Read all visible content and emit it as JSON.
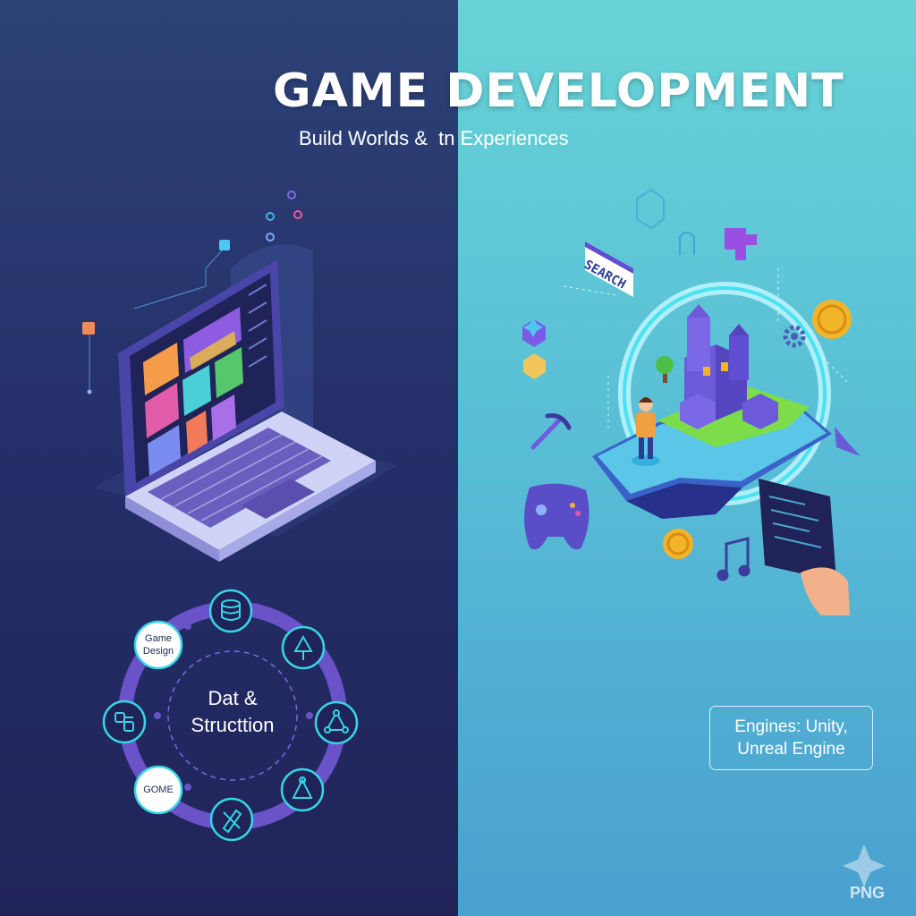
{
  "header": {
    "title": "GAME DEVELOPMENT",
    "subtitle": "Build Worlds &  tn Experiences"
  },
  "cycle": {
    "center_line1": "Dat &",
    "center_line2": "Structtion",
    "node_game_design_line1": "Game",
    "node_game_design_line2": "Design",
    "node_gome": "GOME"
  },
  "scene": {
    "search_label": "SEARCH"
  },
  "engines_box": {
    "line1": "Engines: Unity,",
    "line2": "Unreal Engine"
  },
  "watermark": {
    "text": "PNG"
  },
  "colors": {
    "left_bg": "#25306a",
    "right_bg": "#58bdd6",
    "accent_cyan": "#35d6e6",
    "accent_purple": "#6e5cc9",
    "coin_gold": "#f2b52a"
  },
  "icons": [
    "database-icon",
    "tree-icon",
    "network-icon",
    "path-icon",
    "tools-icon",
    "gamepad-icon",
    "coin-icon",
    "music-note-icon",
    "gear-icon",
    "pickaxe-icon",
    "heart-icon",
    "sparkle-icon"
  ]
}
